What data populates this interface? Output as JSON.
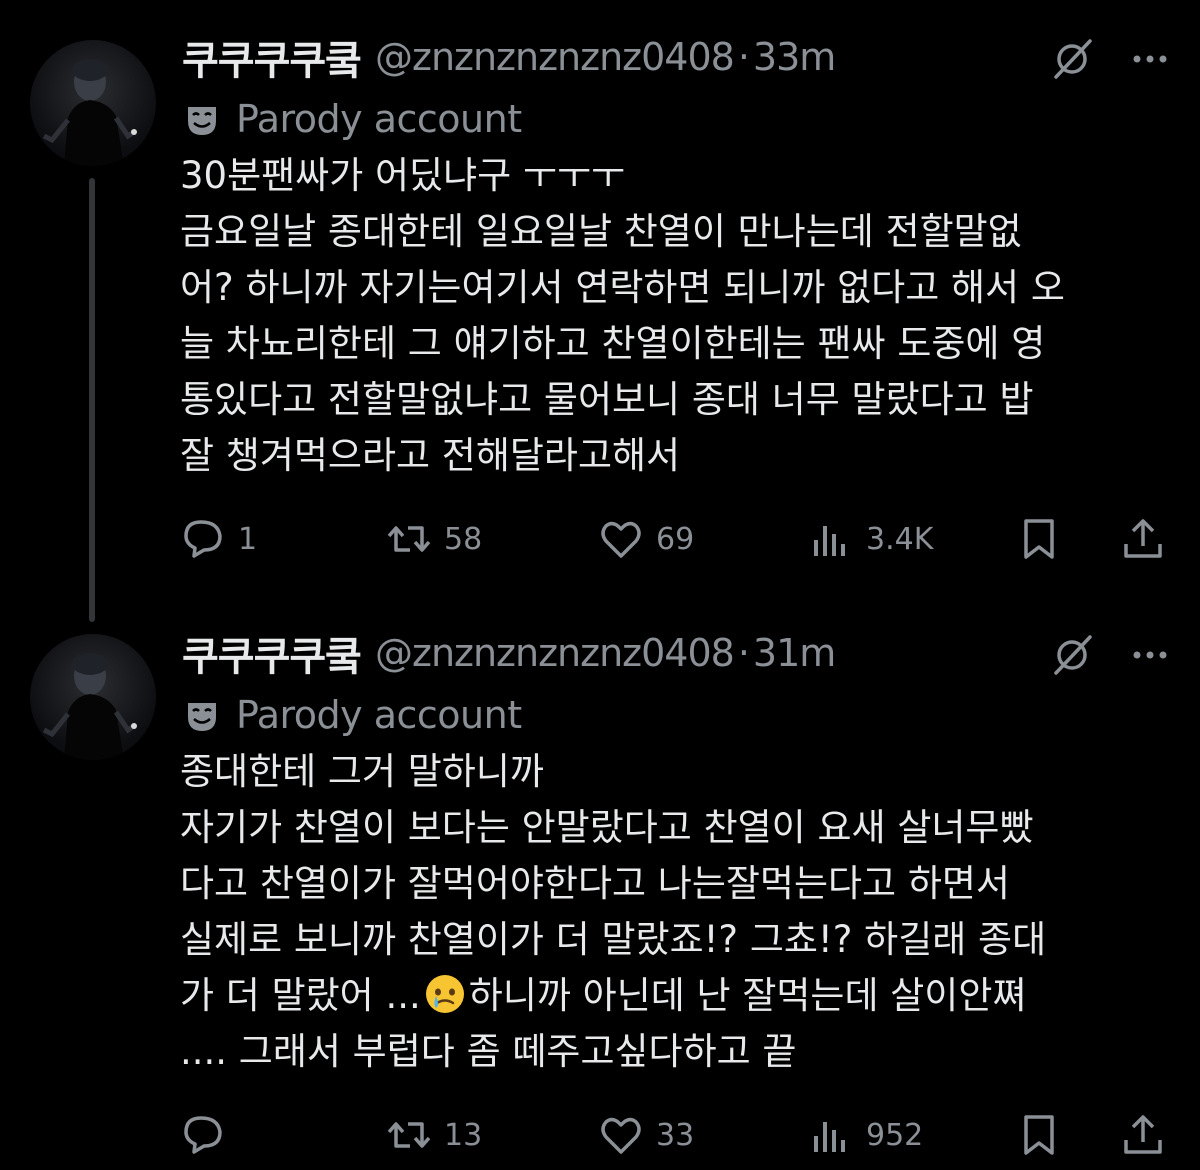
{
  "tweets": [
    {
      "name": "쿠쿠쿠쿠쿸",
      "handle": "@znznznznznz0408",
      "separator": "·",
      "time": "33m",
      "parody_label": "Parody account",
      "body_lines": [
        "30분팬싸가 어딨냐구 ㅜㅜㅜ",
        "금요일날 종대한테 일요일날 찬열이 만나는데 전할말없",
        "어? 하니까 자기는여기서 연락하면 되니까 없다고 해서 오",
        "늘 차뇨리한테 그 얘기하고 찬열이한테는 팬싸 도중에 영",
        "통있다고 전할말없냐고 물어보니 종대 너무 말랐다고 밥",
        "잘 챙겨먹으라고  전해달라고해서"
      ],
      "replies": "1",
      "retweets": "58",
      "likes": "69",
      "views": "3.4K"
    },
    {
      "name": "쿠쿠쿠쿠쿸",
      "handle": "@znznznznznz0408",
      "separator": "·",
      "time": "31m",
      "parody_label": "Parody account",
      "body_lines": [
        "종대한테 그거 말하니까",
        "자기가 찬열이 보다는 안말랐다고 찬열이 요새 살너무빴",
        "다고 찬열이가 잘먹어야한다고 나는잘먹는다고 하면서",
        "실제로 보니까 찬열이가 더 말랐죠!? 그쵸!? 하길래 종대",
        "가 더 말랐어 ...",
        "하니까 아닌데 난 잘먹는데 살이안쪄",
        ".... 그래서 부럽다 좀 떼주고싶다하고 끝"
      ],
      "replies": "",
      "retweets": "13",
      "likes": "33",
      "views": "952"
    }
  ],
  "icons": {
    "reply": "reply-icon",
    "retweet": "retweet-icon",
    "like": "heart-icon",
    "views": "views-icon",
    "bookmark": "bookmark-icon",
    "share": "share-icon",
    "grok": "grok-icon",
    "more": "more-icon",
    "parody": "parody-mask-icon",
    "emoji": "holding-back-tears-emoji"
  },
  "colors": {
    "background": "#000000",
    "text": "#e7e9ea",
    "secondary": "#8b9096",
    "thread_line": "#333639",
    "emoji": "#f7c531"
  }
}
